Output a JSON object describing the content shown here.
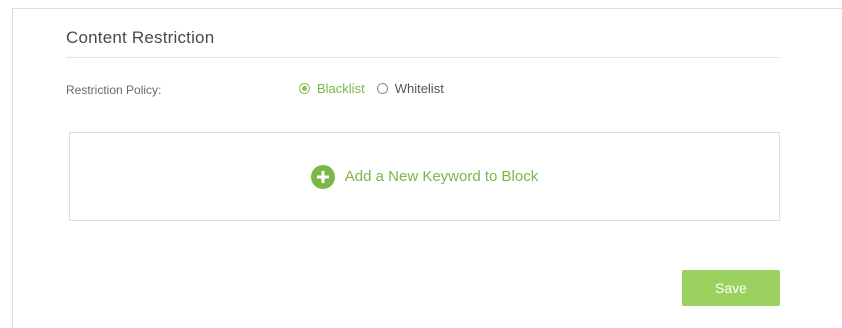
{
  "section": {
    "title": "Content Restriction"
  },
  "policy": {
    "label": "Restriction Policy:",
    "options": [
      {
        "label": "Blacklist",
        "selected": true
      },
      {
        "label": "Whitelist",
        "selected": false
      }
    ]
  },
  "keywords": {
    "add_label": "Add a New Keyword to Block",
    "add_icon": "plus-circle-icon"
  },
  "actions": {
    "save_label": "Save"
  },
  "colors": {
    "accent": "#7ab648",
    "button": "#9bd15f"
  }
}
